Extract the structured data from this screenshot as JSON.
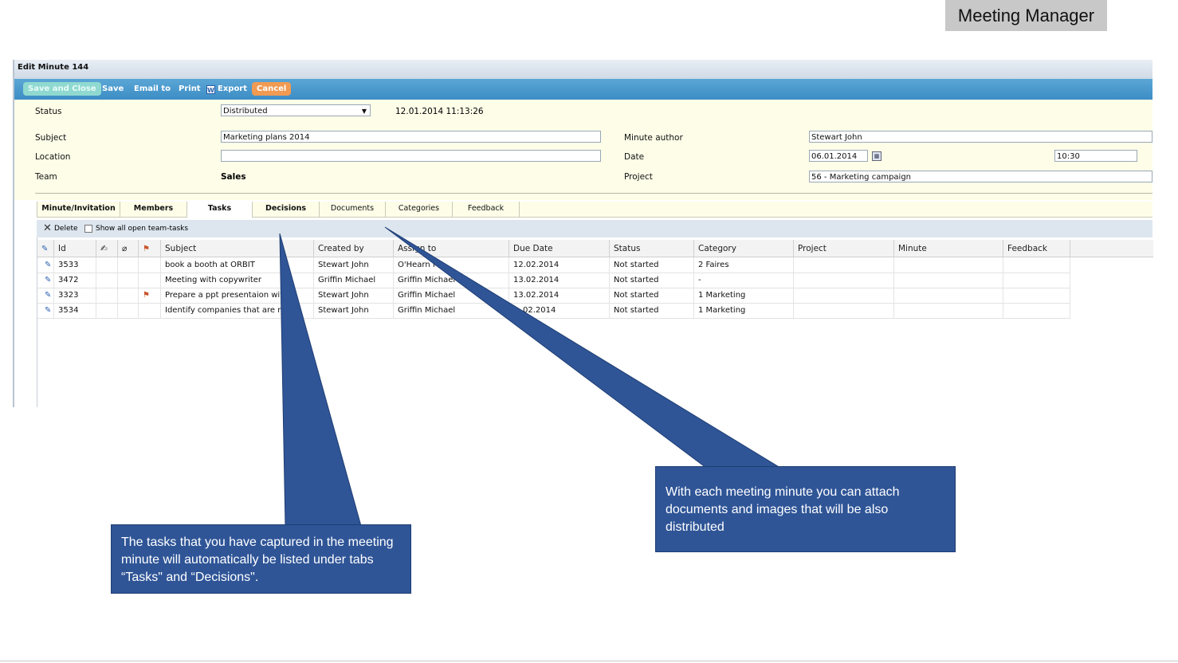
{
  "badge": "Meeting Manager",
  "window": {
    "title": "Edit Minute 144"
  },
  "toolbar": {
    "save_and_close": "Save and Close",
    "save": "Save",
    "email_to": "Email to",
    "print": "Print",
    "export": "Export",
    "cancel": "Cancel"
  },
  "form": {
    "status_label": "Status",
    "status_value": "Distributed",
    "status_timestamp": "12.01.2014 11:13:26",
    "subject_label": "Subject",
    "subject_value": "Marketing plans 2014",
    "location_label": "Location",
    "location_value": "",
    "team_label": "Team",
    "team_value": "Sales",
    "author_label": "Minute author",
    "author_value": "Stewart John",
    "date_label": "Date",
    "date_value": "06.01.2014",
    "time_value": "10:30",
    "project_label": "Project",
    "project_value": "56 - Marketing campaign"
  },
  "tabs": [
    "Minute/Invitation",
    "Members",
    "Tasks",
    "Decisions",
    "Documents",
    "Categories",
    "Feedback"
  ],
  "grid_toolbar": {
    "delete": "Delete",
    "show_all": "Show all open team-tasks"
  },
  "columns": [
    "Id",
    "Subject",
    "Created by",
    "Assign to",
    "Due Date",
    "Status",
    "Category",
    "Project",
    "Minute",
    "Feedback"
  ],
  "rows": [
    {
      "id": "3533",
      "subject": "book a booth at ORBIT",
      "created_by": "Stewart John",
      "assign_to": "O'Hearn M",
      "due_date": "12.02.2014",
      "status": "Not started",
      "category": "2 Faires",
      "flag": false
    },
    {
      "id": "3472",
      "subject": "Meeting with copywriter",
      "created_by": "Griffin Michael",
      "assign_to": "Griffin Michael",
      "due_date": "13.02.2014",
      "status": "Not started",
      "category": "-",
      "flag": false
    },
    {
      "id": "3323",
      "subject": "Prepare a ppt presentaion with",
      "created_by": "Stewart John",
      "assign_to": "Griffin Michael",
      "due_date": "13.02.2014",
      "status": "Not started",
      "category": "1 Marketing",
      "flag": true
    },
    {
      "id": "3534",
      "subject": "Identify companies that are ma",
      "created_by": "Stewart John",
      "assign_to": "Griffin Michael",
      "due_date": "02.2014",
      "status": "Not started",
      "category": "1 Marketing",
      "flag": false
    }
  ],
  "callouts": {
    "left": "The tasks that you have captured in the meeting minute will automatically be listed under tabs “Tasks\" and “Decisions\".",
    "right": "With each meeting minute you can attach documents and images that will be also distributed"
  },
  "colors": {
    "toolbar": "#3d8dc4",
    "form_bg": "#fdfde8",
    "callout": "#2f5597",
    "cancel": "#f19a52"
  }
}
